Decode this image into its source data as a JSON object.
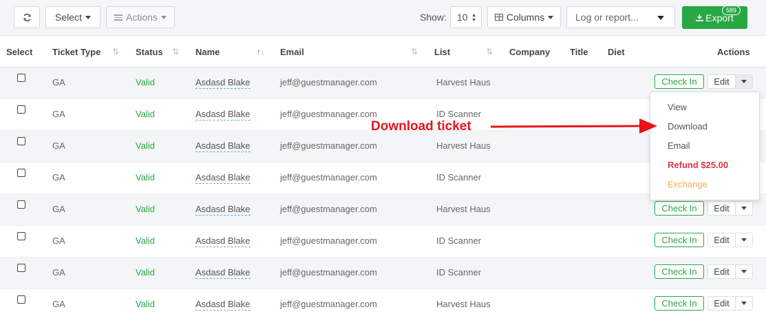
{
  "toolbar": {
    "refresh_icon": "refresh-icon",
    "select_label": "Select",
    "actions_label": "Actions",
    "show_label": "Show:",
    "page_size": "10",
    "columns_label": "Columns",
    "log_placeholder": "Log or report...",
    "export_label": "Export",
    "export_count": "589"
  },
  "columns": [
    "Select",
    "Ticket Type",
    "Status",
    "Name",
    "Email",
    "List",
    "Company",
    "Title",
    "Diet",
    "Actions"
  ],
  "rows": [
    {
      "type": "GA",
      "status": "Valid",
      "name": "Asdasd Blake",
      "email": "jeff@guestmanager.com",
      "list": "Harvest Haus"
    },
    {
      "type": "GA",
      "status": "Valid",
      "name": "Asdasd Blake",
      "email": "jeff@guestmanager.com",
      "list": "ID Scanner"
    },
    {
      "type": "GA",
      "status": "Valid",
      "name": "Asdasd Blake",
      "email": "jeff@guestmanager.com",
      "list": "Harvest Haus"
    },
    {
      "type": "GA",
      "status": "Valid",
      "name": "Asdasd Blake",
      "email": "jeff@guestmanager.com",
      "list": "ID Scanner"
    },
    {
      "type": "GA",
      "status": "Valid",
      "name": "Asdasd Blake",
      "email": "jeff@guestmanager.com",
      "list": "Harvest Haus"
    },
    {
      "type": "GA",
      "status": "Valid",
      "name": "Asdasd Blake",
      "email": "jeff@guestmanager.com",
      "list": "ID Scanner"
    },
    {
      "type": "GA",
      "status": "Valid",
      "name": "Asdasd Blake",
      "email": "jeff@guestmanager.com",
      "list": "ID Scanner"
    },
    {
      "type": "GA",
      "status": "Valid",
      "name": "Asdasd Blake",
      "email": "jeff@guestmanager.com",
      "list": "Harvest Haus"
    }
  ],
  "row_actions": {
    "checkin_label": "Check In",
    "edit_label": "Edit"
  },
  "dropdown": {
    "view": "View",
    "download": "Download",
    "email": "Email",
    "refund": "Refund $25.00",
    "exchange": "Exchange"
  },
  "annotation": {
    "text": "Download ticket",
    "color": "#e8141c"
  },
  "colors": {
    "success": "#28a745",
    "danger": "#dc3545",
    "warning": "#f0ad4e"
  }
}
